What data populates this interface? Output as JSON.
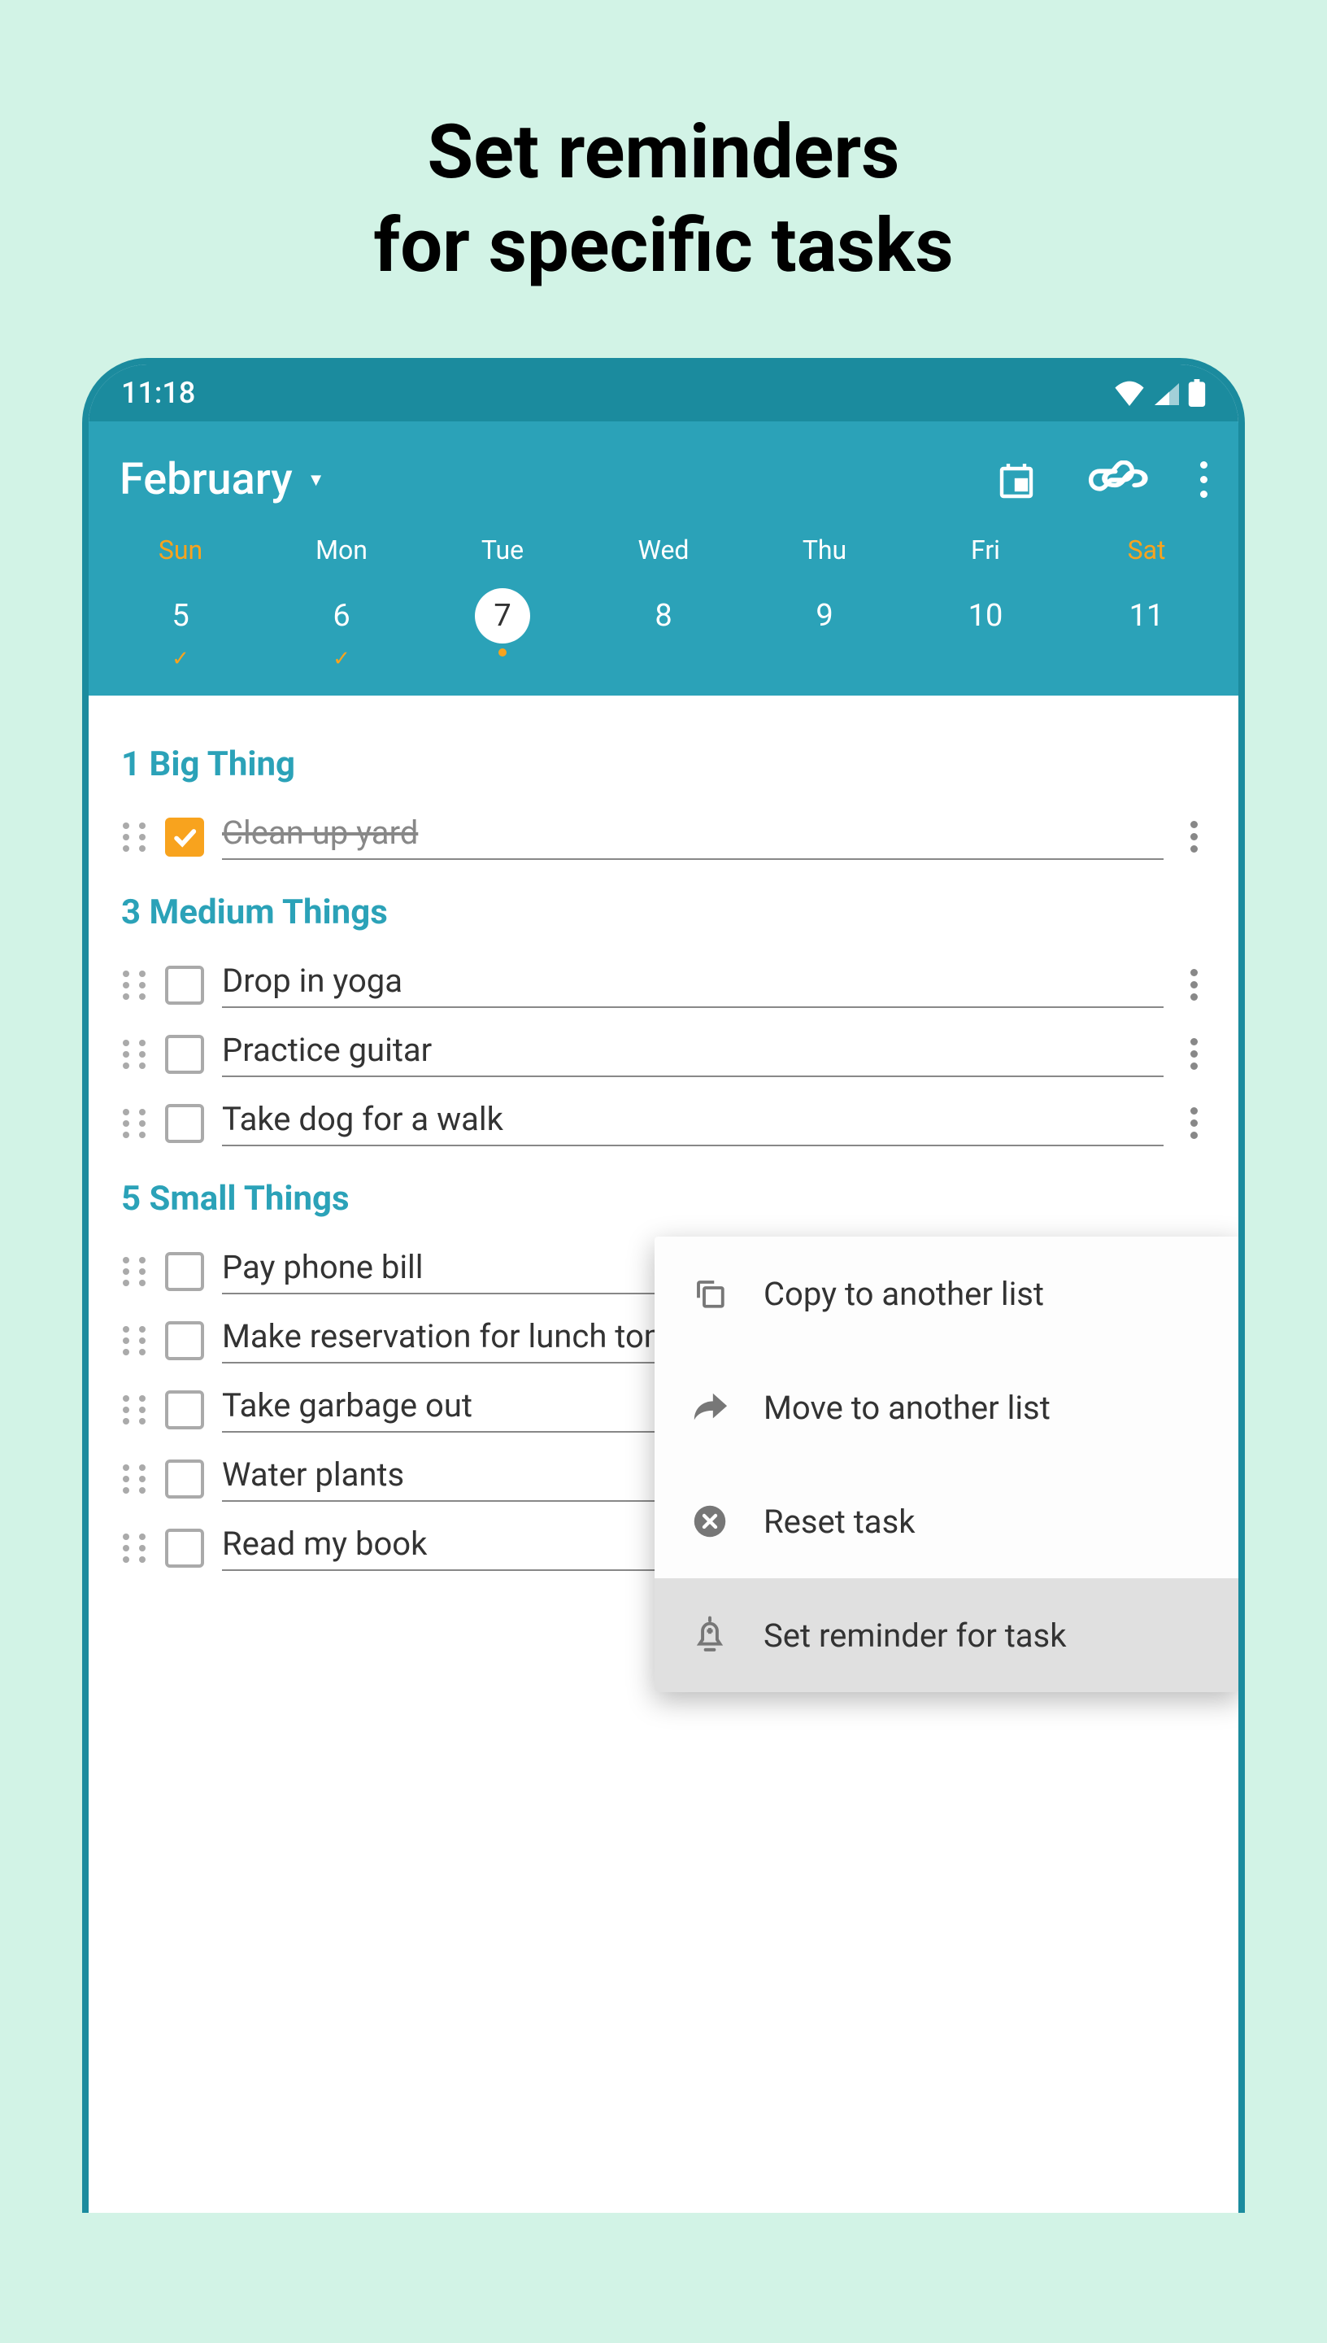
{
  "hero": {
    "line1": "Set reminders",
    "line2": "for specific tasks"
  },
  "status": {
    "time": "11:18"
  },
  "header": {
    "month": "February"
  },
  "week": [
    {
      "label": "Sun",
      "num": "5",
      "weekend": true,
      "checked": true,
      "selected": false
    },
    {
      "label": "Mon",
      "num": "6",
      "weekend": false,
      "checked": true,
      "selected": false
    },
    {
      "label": "Tue",
      "num": "7",
      "weekend": false,
      "checked": false,
      "selected": true
    },
    {
      "label": "Wed",
      "num": "8",
      "weekend": false,
      "checked": false,
      "selected": false
    },
    {
      "label": "Thu",
      "num": "9",
      "weekend": false,
      "checked": false,
      "selected": false
    },
    {
      "label": "Fri",
      "num": "10",
      "weekend": false,
      "checked": false,
      "selected": false
    },
    {
      "label": "Sat",
      "num": "11",
      "weekend": true,
      "checked": false,
      "selected": false
    }
  ],
  "sections": {
    "big": {
      "title": "1 Big Thing",
      "tasks": [
        {
          "text": "Clean up yard",
          "done": true
        }
      ]
    },
    "medium": {
      "title": "3 Medium Things",
      "tasks": [
        {
          "text": "Drop in yoga",
          "done": false
        },
        {
          "text": "Practice guitar",
          "done": false
        },
        {
          "text": "Take dog for a walk",
          "done": false
        }
      ]
    },
    "small": {
      "title": "5 Small Things",
      "tasks": [
        {
          "text": "Pay phone bill",
          "done": false
        },
        {
          "text": "Make reservation for lunch tomorrow",
          "done": false
        },
        {
          "text": "Take garbage out",
          "done": false
        },
        {
          "text": "Water plants",
          "done": false
        },
        {
          "text": "Read my book",
          "done": false
        }
      ]
    }
  },
  "menu": {
    "copy": "Copy to another list",
    "move": "Move to another list",
    "reset": "Reset task",
    "remind": "Set reminder for task"
  }
}
